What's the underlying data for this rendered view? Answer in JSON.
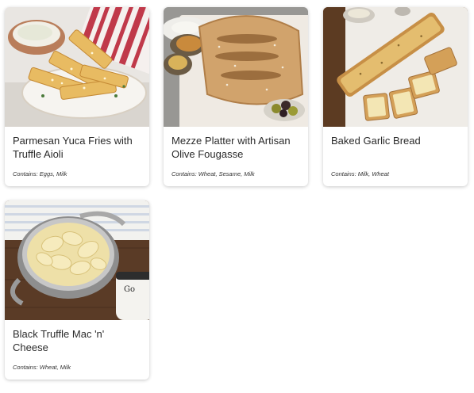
{
  "menu": {
    "items": [
      {
        "name": "Parmesan Yuca Fries with Truffle Aioli",
        "allergens": "Contains: Eggs, Milk",
        "image": "yuca-fries-photo"
      },
      {
        "name": "Mezze Platter with Artisan Olive Fougasse",
        "allergens": "Contains: Wheat, Sesame, Milk",
        "image": "mezze-platter-photo"
      },
      {
        "name": "Baked Garlic Bread",
        "allergens": "Contains: Milk, Wheat",
        "image": "garlic-bread-photo"
      },
      {
        "name": "Black Truffle Mac 'n' Cheese",
        "allergens": "Contains: Wheat, Milk",
        "image": "mac-cheese-photo"
      }
    ]
  }
}
